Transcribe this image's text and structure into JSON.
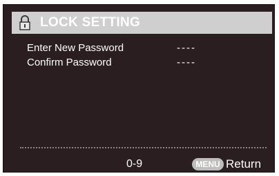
{
  "title": "LOCK SETTING",
  "title_icon": "padlock-icon",
  "rows": [
    {
      "label": "Enter New Password",
      "value": "----"
    },
    {
      "label": "Confirm Password",
      "value": "----"
    }
  ],
  "footer": {
    "hint": "0-9",
    "menu_button": "MENU",
    "return_label": "Return"
  },
  "colors": {
    "background": "#2b1e20",
    "title_bar": "#cfcfcf",
    "text": "#ffffff",
    "menu_pill": "#bdbdbd"
  }
}
